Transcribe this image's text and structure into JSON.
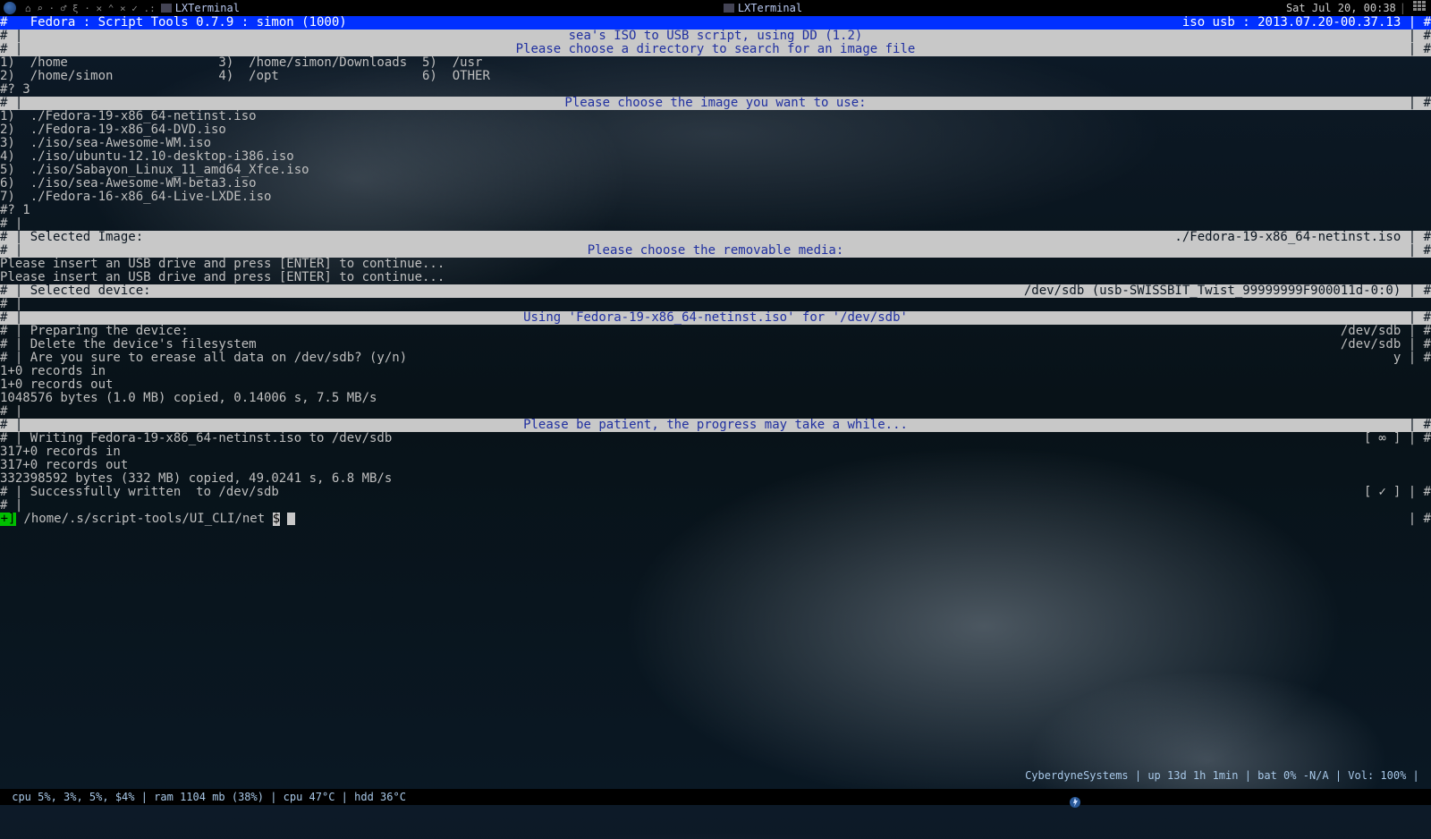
{
  "taskbar": {
    "symbols": "⌂ ⌕ · ♂ ξ · ✕ ⌃ × ✓ .:",
    "win1": "LXTerminal",
    "win2": "LXTerminal",
    "clock": "Sat Jul 20, 00:38"
  },
  "titlebar": {
    "left": "#   Fedora : Script Tools 0.7.9 : simon (1000)",
    "right": "iso usb : 2013.07.20-00.37.13 | #"
  },
  "hdr1": {
    "l": "# |",
    "txt": "sea's ISO to USB script, using DD (1.2)",
    "r": "| #"
  },
  "hdr1b": {
    "l": "# |",
    "txt": "Please choose a directory to search for an image file",
    "r": "| #"
  },
  "dirs": [
    "1)  /home                    3)  /home/simon/Downloads  5)  /usr",
    "2)  /home/simon              4)  /opt                   6)  OTHER",
    "#? 3"
  ],
  "hdr2": {
    "l": "# |",
    "txt": "Please choose the image you want to use:",
    "r": "| #"
  },
  "imgs": [
    "1)  ./Fedora-19-x86_64-netinst.iso",
    "2)  ./Fedora-19-x86_64-DVD.iso",
    "3)  ./iso/sea-Awesome-WM.iso",
    "4)  ./iso/ubuntu-12.10-desktop-i386.iso",
    "5)  ./iso/Sabayon_Linux_11_amd64_Xfce.iso",
    "6)  ./iso/sea-Awesome-WM-beta3.iso",
    "7)  ./Fedora-16-x86_64-Live-LXDE.iso",
    "#? 1",
    "# |"
  ],
  "sel_img": {
    "l": "# | Selected Image:",
    "r": "./Fedora-19-x86_64-netinst.iso | #"
  },
  "hdr3": {
    "l": "# |",
    "txt": "Please choose the removable media:",
    "r": "| #"
  },
  "usb1": "Please insert an USB drive and press [ENTER] to continue...",
  "usb2": "Please insert an USB drive and press [ENTER] to continue...",
  "sel_dev": {
    "l": "# | Selected device:",
    "r": "/dev/sdb (usb-SWISSBIT_Twist_99999999F900011d-0:0) | #"
  },
  "hashline": "# |",
  "hdr4": {
    "l": "# |",
    "txt": "Using 'Fedora-19-x86_64-netinst.iso' for '/dev/sdb'",
    "r": "| #"
  },
  "prep": [
    {
      "l": "# | Preparing the device:",
      "r": "/dev/sdb | #"
    },
    {
      "l": "# | Delete the device's filesystem",
      "r": "/dev/sdb | #"
    },
    {
      "l": "# | Are you sure to erease all data on /dev/sdb? (y/n)",
      "r": "y | #"
    }
  ],
  "dd1": [
    "1+0 records in",
    "1+0 records out",
    "1048576 bytes (1.0 MB) copied, 0.14006 s, 7.5 MB/s",
    "# |"
  ],
  "hdr5": {
    "l": "# |",
    "txt": "Please be patient, the progress may take a while...",
    "r": "| #"
  },
  "write": {
    "l": "# | Writing Fedora-19-x86_64-netinst.iso to /dev/sdb",
    "sym": "∞",
    "r": "] | #",
    "lb": "["
  },
  "dd2": [
    "317+0 records in",
    "317+0 records out",
    "332398592 bytes (332 MB) copied, 49.0241 s, 6.8 MB/s"
  ],
  "success": {
    "l": "# | Successfully written  to /dev/sdb",
    "sym": "✓",
    "r": "] | #",
    "lb": "["
  },
  "hashline2": "# |",
  "prompt": {
    "sym": "+]",
    "path": " /home/.s/script-tools/UI_CLI/net ",
    "dollar": "$",
    "r": "| #"
  },
  "bottom": {
    "left": " cpu 5%, 3%, 5%, $4% | ram 1104 mb (38%) | cpu 47°C | hdd 36°C",
    "right": "CyberdyneSystems | up 13d 1h 1min | bat 0% -N/A | Vol: 100% | "
  }
}
